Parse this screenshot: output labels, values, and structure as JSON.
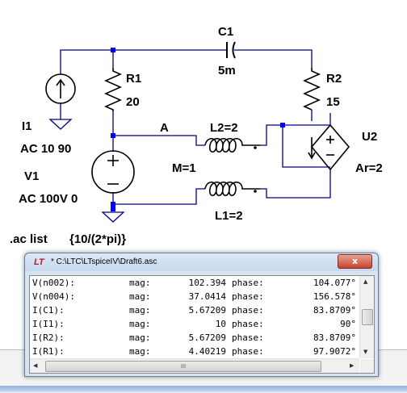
{
  "schematic": {
    "components": {
      "c1": {
        "name": "C1",
        "value": "5m"
      },
      "r1": {
        "name": "R1",
        "value": "20"
      },
      "r2": {
        "name": "R2",
        "value": "15"
      },
      "i1": {
        "name": "I1",
        "value": "AC 10 90"
      },
      "v1": {
        "name": "V1",
        "value": "AC 100V 0"
      },
      "l1": {
        "name": "L1=2"
      },
      "l2": {
        "name": "L2=2"
      },
      "m": {
        "name": "M=1"
      },
      "u2": {
        "name": "U2",
        "value": "Ar=2"
      },
      "node_a": {
        "name": "A"
      }
    },
    "directive": {
      "label": ".ac list",
      "value": "{10/(2*pi)}"
    },
    "colors": {
      "wire": "#000080",
      "node": "#0000ff",
      "body": "#000000"
    }
  },
  "window": {
    "icon": "ltspice-icon",
    "title": "* C:\\LTC\\LTspiceIV\\Draft6.asc",
    "close_label": "x",
    "rows": [
      {
        "name": "V(n002):",
        "mag_label": "mag:",
        "mag": "102.394",
        "phase_label": "phase:",
        "phase": "104.077°"
      },
      {
        "name": "V(n004):",
        "mag_label": "mag:",
        "mag": "37.0414",
        "phase_label": "phase:",
        "phase": "156.578°"
      },
      {
        "name": "I(C1):",
        "mag_label": "mag:",
        "mag": "5.67209",
        "phase_label": "phase:",
        "phase": "83.8709°"
      },
      {
        "name": "I(I1):",
        "mag_label": "mag:",
        "mag": "10",
        "phase_label": "phase:",
        "phase": "90°"
      },
      {
        "name": "I(R2):",
        "mag_label": "mag:",
        "mag": "5.67209",
        "phase_label": "phase:",
        "phase": "83.8709°"
      },
      {
        "name": "I(R1):",
        "mag_label": "mag:",
        "mag": "4.40219",
        "phase_label": "phase:",
        "phase": "97.9072°"
      }
    ],
    "hthumb_grip": "III"
  }
}
